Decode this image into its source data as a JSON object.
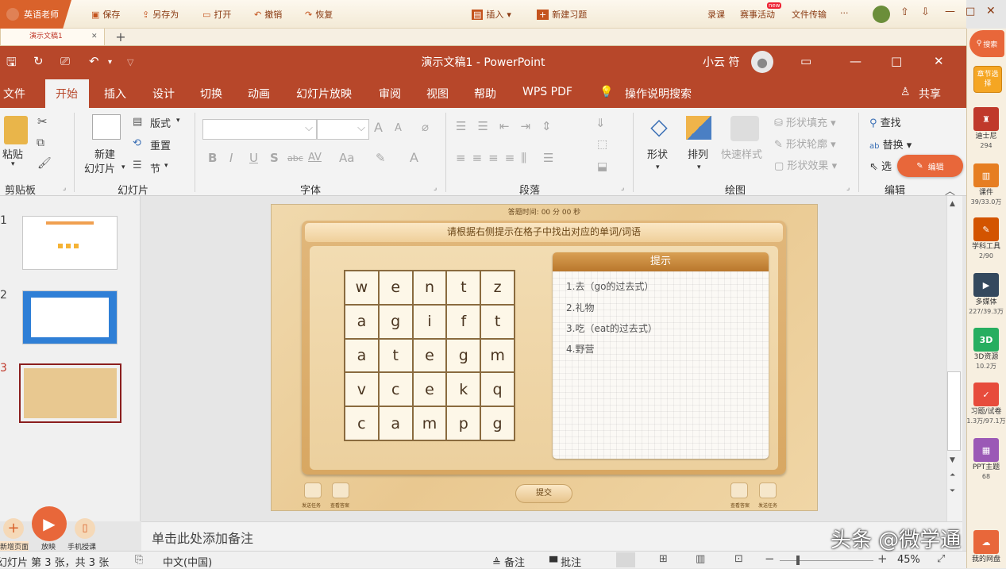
{
  "host": {
    "app_name": "英语老师",
    "save": "保存",
    "save_as": "另存为",
    "open": "打开",
    "undo": "撤销",
    "redo": "恢复",
    "insert": "插入",
    "new_exercise": "新建习题",
    "record": "录课",
    "contest": "赛事活动",
    "new_badge": "new",
    "file_transfer": "文件传输",
    "more": "···",
    "doc_tab": "演示文稿1"
  },
  "window": {
    "title": "演示文稿1  -  PowerPoint",
    "user": "小云 符"
  },
  "menu": {
    "items": [
      "文件",
      "开始",
      "插入",
      "设计",
      "切换",
      "动画",
      "幻灯片放映",
      "审阅",
      "视图",
      "帮助",
      "WPS PDF"
    ],
    "tell_me": "操作说明搜索",
    "share": "共享"
  },
  "ribbon": {
    "clipboard": {
      "paste": "粘贴",
      "label": "剪贴板"
    },
    "slides": {
      "new_slide_1": "新建",
      "new_slide_2": "幻灯片",
      "layout": "版式",
      "reset": "重置",
      "section": "节",
      "label": "幻灯片"
    },
    "font": {
      "label": "字体",
      "bold": "B",
      "italic": "I",
      "underline": "U",
      "shadow": "S",
      "strike": "abc",
      "spacing": "AV",
      "case": "Aa",
      "grow": "A",
      "shrink": "A"
    },
    "paragraph": {
      "label": "段落"
    },
    "drawing": {
      "shape": "形状",
      "arrange": "排列",
      "quick_style": "快速样式",
      "fill": "形状填充",
      "outline": "形状轮廓",
      "effect": "形状效果",
      "label": "绘图"
    },
    "editing": {
      "find": "查找",
      "replace": "替换",
      "select": "选",
      "label": "编辑"
    }
  },
  "thumbs": [
    "1",
    "2",
    "3"
  ],
  "slide": {
    "timer": "答题时间:  00 分 00 秒",
    "instruction": "请根据右侧提示在格子中找出对应的单词/词语",
    "grid": [
      [
        "w",
        "e",
        "n",
        "t",
        "z"
      ],
      [
        "a",
        "g",
        "i",
        "f",
        "t"
      ],
      [
        "a",
        "t",
        "e",
        "g",
        "m"
      ],
      [
        "v",
        "c",
        "e",
        "k",
        "q"
      ],
      [
        "c",
        "a",
        "m",
        "p",
        "g"
      ]
    ],
    "hint_title": "提示",
    "hints": [
      "1.去（go的过去式）",
      "2.礼物",
      "3.吃（eat的过去式）",
      "4.野营"
    ],
    "submit": "提交",
    "tool_left_1": "发送任务",
    "tool_left_2": "查看答案",
    "tool_right_1": "查看答案",
    "tool_right_2": "发送任务"
  },
  "notes": {
    "placeholder": "单击此处添加备注"
  },
  "status": {
    "slide_info": "幻灯片 第 3 张，共 3 张",
    "language": "中文(中国)",
    "notes": "备注",
    "comments": "批注",
    "zoom": "45%"
  },
  "bottom_tools": {
    "new_page": "新增页面",
    "play": "放映",
    "phone": "手机授课"
  },
  "edit_badge": "编辑",
  "watermark": "头条 @微学通",
  "sidebar": [
    {
      "label": "搜索",
      "count": ""
    },
    {
      "label": "章节选择",
      "count": ""
    },
    {
      "label": "迪士尼",
      "count": "294"
    },
    {
      "label": "课件",
      "count": "39/33.0万"
    },
    {
      "label": "学科工具",
      "count": "2/90"
    },
    {
      "label": "多媒体",
      "count": "227/39.3万"
    },
    {
      "label": "3D资源",
      "count": "10.2万"
    },
    {
      "label": "习题/试卷",
      "count": "1.3万/97.1万"
    },
    {
      "label": "PPT主题",
      "count": "68"
    },
    {
      "label": "我的网盘",
      "count": ""
    }
  ]
}
